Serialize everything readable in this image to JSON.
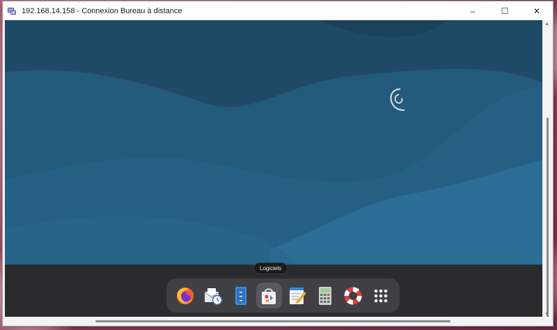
{
  "window": {
    "title": "192.168.14.158 - Connexion Bureau à distance",
    "controls": {
      "minimize": "–",
      "maximize": "☐",
      "close": "✕"
    }
  },
  "desktop": {
    "wallpaper": "debian-swirl",
    "colors": {
      "dark": "#1f4a66",
      "mid": "#245a7c",
      "light": "#2b6d95"
    }
  },
  "panel": {
    "tooltip": "Logiciels",
    "dock_items": [
      {
        "name": "Firefox",
        "icon": "firefox-icon",
        "active": false
      },
      {
        "name": "Evolution",
        "icon": "mail-clock-icon",
        "active": false
      },
      {
        "name": "Fichiers",
        "icon": "files-icon",
        "active": false
      },
      {
        "name": "Logiciels",
        "icon": "software-store-icon",
        "active": true
      },
      {
        "name": "Éditeur de texte",
        "icon": "text-editor-icon",
        "active": false
      },
      {
        "name": "Calculatrice",
        "icon": "calculator-icon",
        "active": false
      },
      {
        "name": "Aide",
        "icon": "help-lifebuoy-icon",
        "active": false
      },
      {
        "name": "Applications",
        "icon": "app-grid-icon",
        "active": false
      }
    ]
  }
}
